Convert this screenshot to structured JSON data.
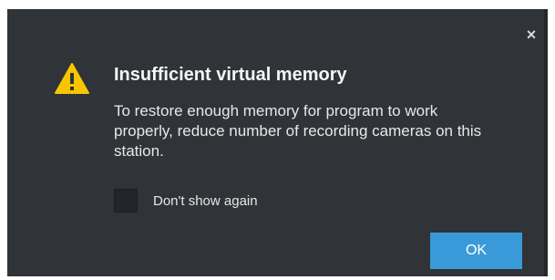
{
  "dialog": {
    "title": "Insufficient virtual memory",
    "message": "To restore enough memory for program to work properly, reduce number of recording cameras on this station.",
    "close_icon": "close-icon",
    "close_glyph": "×",
    "warning_icon": "warning-icon",
    "checkbox": {
      "label": "Don't show again",
      "checked": false
    },
    "ok_label": "OK"
  },
  "colors": {
    "dialog_background": "#303337",
    "warning_yellow": "#f7c600",
    "ok_button": "#3a9ad9"
  }
}
